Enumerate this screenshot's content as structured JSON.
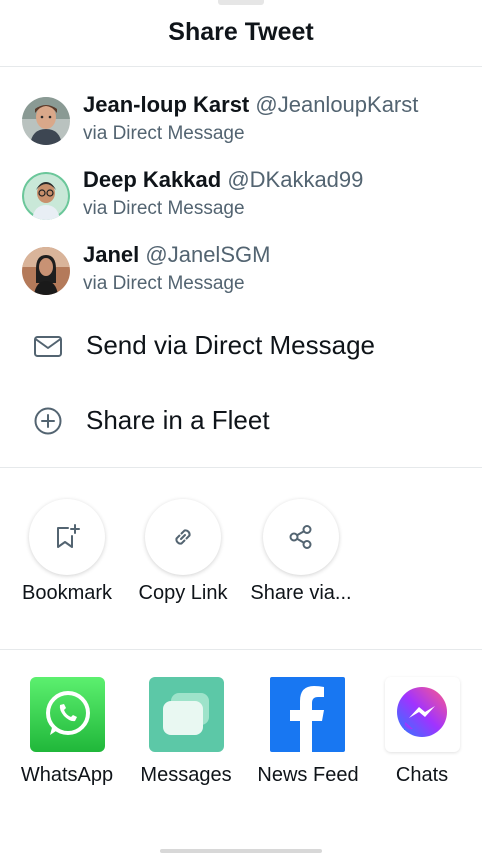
{
  "sheet": {
    "title": "Share Tweet"
  },
  "contacts": [
    {
      "name": "Jean-loup Karst",
      "handle": "@JeanloupKarst",
      "via": "via Direct Message"
    },
    {
      "name": "Deep Kakkad",
      "handle": "@DKakkad99",
      "via": "via Direct Message"
    },
    {
      "name": "Janel",
      "handle": "@JanelSGM",
      "via": "via Direct Message"
    }
  ],
  "actions": {
    "send_dm": {
      "label": "Send via Direct Message",
      "icon": "envelope-icon"
    },
    "fleet": {
      "label": "Share in a Fleet",
      "icon": "plus-circle-icon"
    }
  },
  "quick_actions": [
    {
      "label": "Bookmark",
      "icon": "bookmark-add-icon"
    },
    {
      "label": "Copy Link",
      "icon": "link-icon"
    },
    {
      "label": "Share via...",
      "icon": "share-icon"
    }
  ],
  "apps": [
    {
      "label": "WhatsApp",
      "icon": "whatsapp-icon",
      "color": "#25D366"
    },
    {
      "label": "Messages",
      "icon": "messages-icon",
      "color": "#5CC8A7"
    },
    {
      "label": "News Feed",
      "icon": "facebook-icon",
      "color": "#1877F2"
    },
    {
      "label": "Chats",
      "icon": "messenger-icon",
      "color": "#A033FF"
    }
  ]
}
